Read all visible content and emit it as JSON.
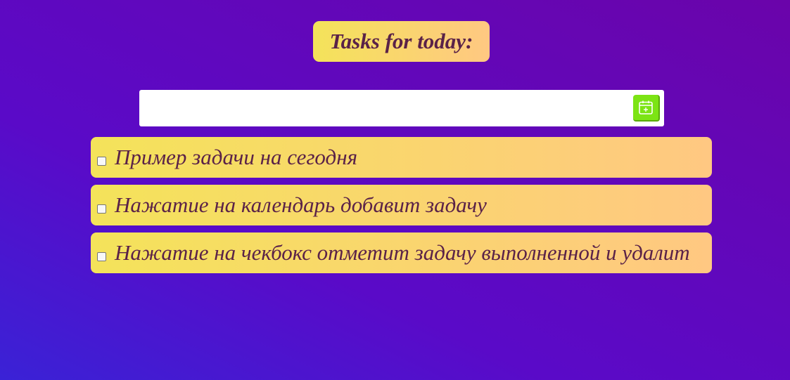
{
  "header": {
    "title": "Tasks for today:"
  },
  "new_task": {
    "value": "",
    "placeholder": "",
    "add_button_icon": "calendar-plus-icon"
  },
  "tasks": [
    {
      "text": "Пример задачи на сегодня",
      "done": false
    },
    {
      "text": "Нажатие на календарь добавит задачу",
      "done": false
    },
    {
      "text": "Нажатие на чекбокс отметит задачу выполненной и удалит",
      "done": false
    }
  ],
  "colors": {
    "background_start": "#3a22d6",
    "background_end": "#6a04aa",
    "card_start": "#f4e35a",
    "card_end": "#ffc882",
    "text": "#5a2248",
    "add_button": "#7ce414"
  }
}
